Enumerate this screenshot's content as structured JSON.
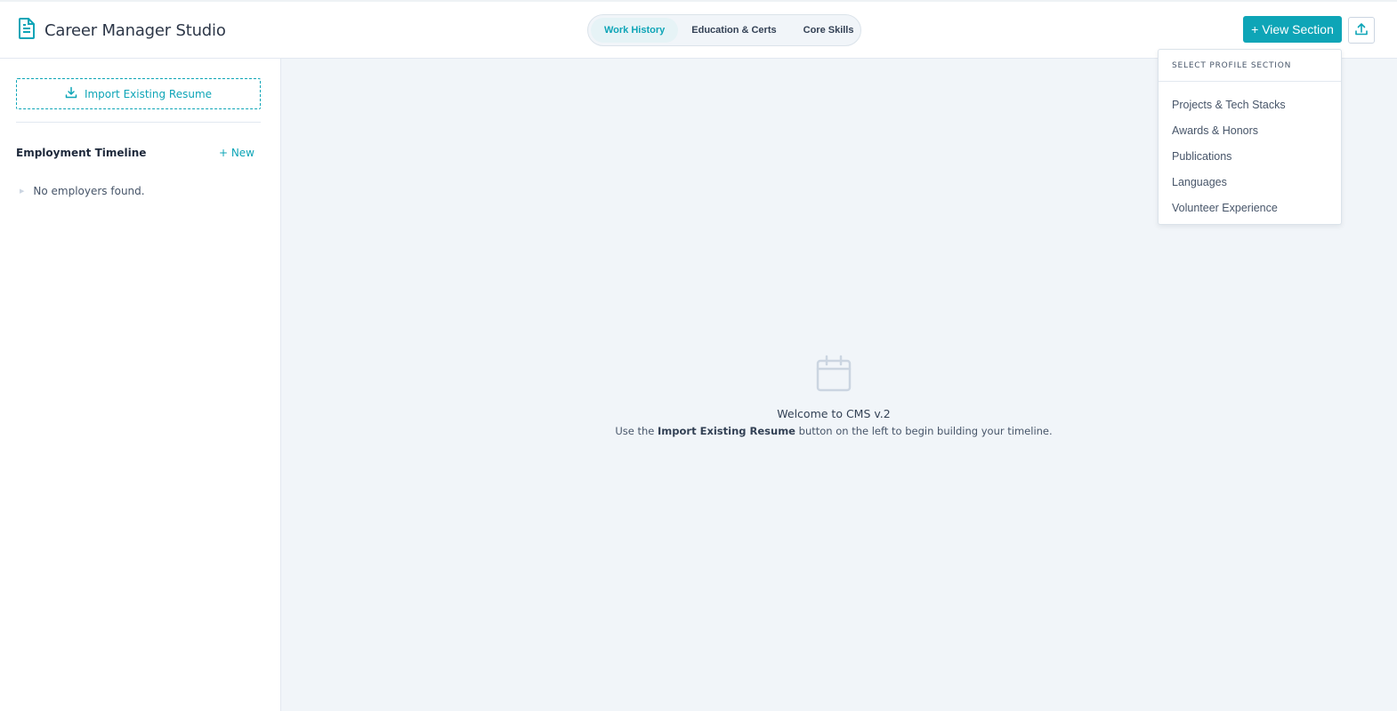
{
  "app": {
    "title": "Career Manager Studio",
    "accent_color": "#0ea5b7",
    "brand_icon": "document-icon"
  },
  "header": {
    "tabs": [
      {
        "label": "Work History",
        "active": true
      },
      {
        "label": "Education & Certs",
        "active": false
      },
      {
        "label": "Core Skills",
        "active": false
      }
    ],
    "view_section_label": "+ View Section",
    "upload_icon": "upload-icon"
  },
  "sidebar": {
    "import_label": "Import Existing Resume",
    "import_icon": "download-icon",
    "timeline_title": "Employment Timeline",
    "new_label": "+ New",
    "empty_text": "No employers found."
  },
  "main": {
    "empty_icon": "calendar-icon",
    "welcome_title": "Welcome to CMS v.2",
    "welcome_prefix": "Use the",
    "welcome_bold": "Import Existing Resume",
    "welcome_suffix": "button on the left to begin building your timeline."
  },
  "dropdown": {
    "header": "SELECT PROFILE SECTION",
    "items": [
      "Projects & Tech Stacks",
      "Awards & Honors",
      "Publications",
      "Languages",
      "Volunteer Experience"
    ]
  }
}
